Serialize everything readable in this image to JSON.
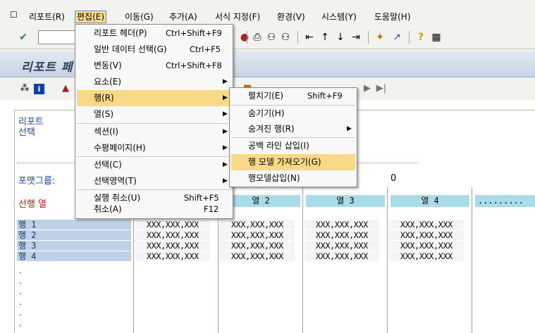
{
  "menubar": {
    "items": [
      "리포트(R)",
      "편집(E)",
      "이동(G)",
      "추가(A)",
      "서식 지정(F)",
      "환경(V)",
      "시스템(Y)",
      "도움말(H)"
    ]
  },
  "title": "리포트 페",
  "content": {
    "report_select": "리포트\n선택",
    "format_group": "포맷그룹:",
    "zero_value": "0",
    "row_col": "선행 열",
    "columns": [
      "열 2",
      "열 3",
      "열 4",
      "........."
    ],
    "rows": [
      "행  1",
      "행  2",
      "행  3",
      "행  4"
    ],
    "cell_value": "XXX,XXX,XXX",
    "dots": [
      ".",
      ".",
      ".",
      ".",
      ".",
      "."
    ]
  },
  "edit_menu": {
    "items": [
      {
        "label": "리포트 헤더(P)",
        "shortcut": "Ctrl+Shift+F9"
      },
      {
        "label": "일반 데이터 선택(G)",
        "shortcut": "Ctrl+F5"
      },
      {
        "label": "변동(V)",
        "shortcut": "Ctrl+Shift+F8"
      },
      {
        "label": "요소(E)",
        "shortcut": ""
      },
      {
        "label": "행(R)",
        "shortcut": ""
      },
      {
        "label": "열(S)",
        "shortcut": ""
      },
      {
        "label": "섹션(I)",
        "shortcut": ""
      },
      {
        "label": "수평페이지(H)",
        "shortcut": ""
      },
      {
        "label": "선택(C)",
        "shortcut": ""
      },
      {
        "label": "선택영역(T)",
        "shortcut": ""
      },
      {
        "label": "실행 취소(U)",
        "shortcut": "Shift+F5"
      },
      {
        "label": "취소(A)",
        "shortcut": "F12"
      }
    ]
  },
  "row_submenu": {
    "items": [
      {
        "label": "펼치기(E)",
        "shortcut": "Shift+F9"
      },
      {
        "label": "숨기기(H)",
        "shortcut": ""
      },
      {
        "label": "숨겨진 행(R)",
        "shortcut": ""
      },
      {
        "label": "공백 라인 삽입(I)",
        "shortcut": ""
      },
      {
        "label": "행 모델 가져오기(G)",
        "shortcut": ""
      },
      {
        "label": "행모델삽입(N)",
        "shortcut": ""
      }
    ]
  },
  "colors": {
    "menu_highlight": "#f8d985",
    "column_header": "#a9dce8",
    "row_label": "#bed1e6",
    "title_text": "#2d3f5b",
    "row_col_label": "#c81414"
  }
}
